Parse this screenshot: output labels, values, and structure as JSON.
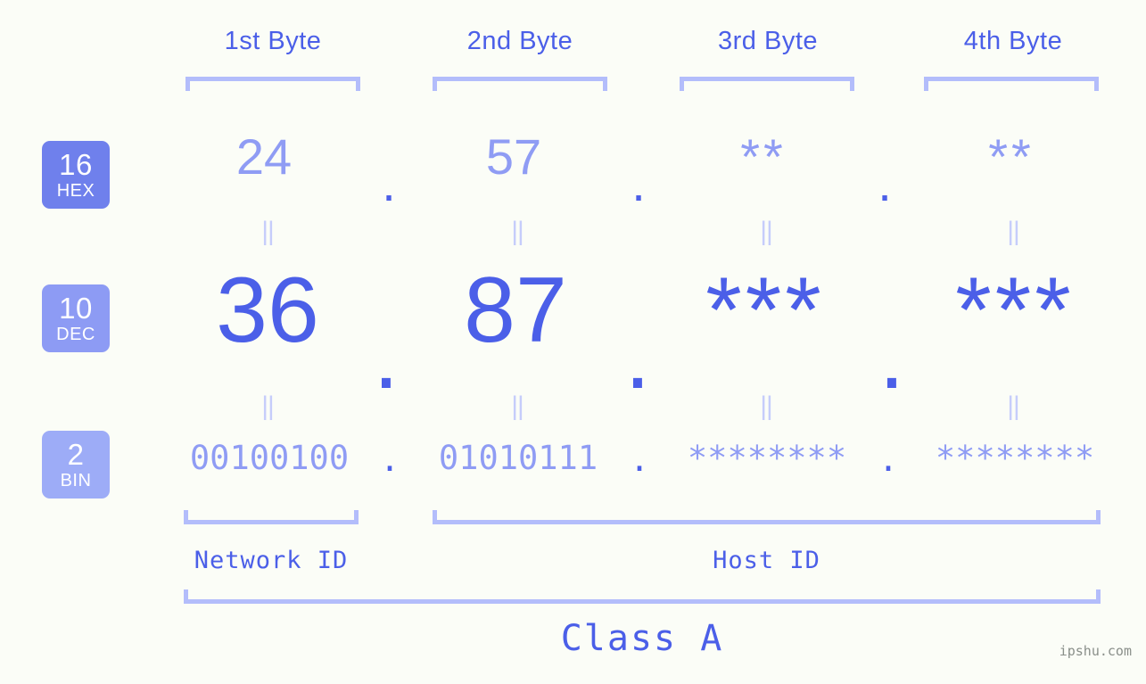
{
  "meta": {
    "background": "#fbfdf7",
    "accent_strong": "#4b5fe8",
    "accent_mid": "#8f9cf4",
    "accent_light": "#b3bdfb",
    "watermark": "ipshu.com"
  },
  "headers": {
    "bytes": [
      "1st Byte",
      "2nd Byte",
      "3rd Byte",
      "4th Byte"
    ]
  },
  "bases": [
    {
      "num": "16",
      "name": "HEX",
      "color": "#6f80ec"
    },
    {
      "num": "10",
      "name": "DEC",
      "color": "#8d9bf4"
    },
    {
      "num": "2",
      "name": "BIN",
      "color": "#9dacf7"
    }
  ],
  "rows": {
    "hex": {
      "values": [
        "24",
        "57",
        "**",
        "**"
      ],
      "separator": "."
    },
    "dec": {
      "values": [
        "36",
        "87",
        "***",
        "***"
      ],
      "separator": "."
    },
    "bin": {
      "values": [
        "00100100",
        "01010111",
        "********",
        "********"
      ],
      "separator": "."
    }
  },
  "connectors": {
    "symbol": "||"
  },
  "footer": {
    "network_id_label": "Network ID",
    "host_id_label": "Host ID",
    "class_label": "Class A"
  }
}
